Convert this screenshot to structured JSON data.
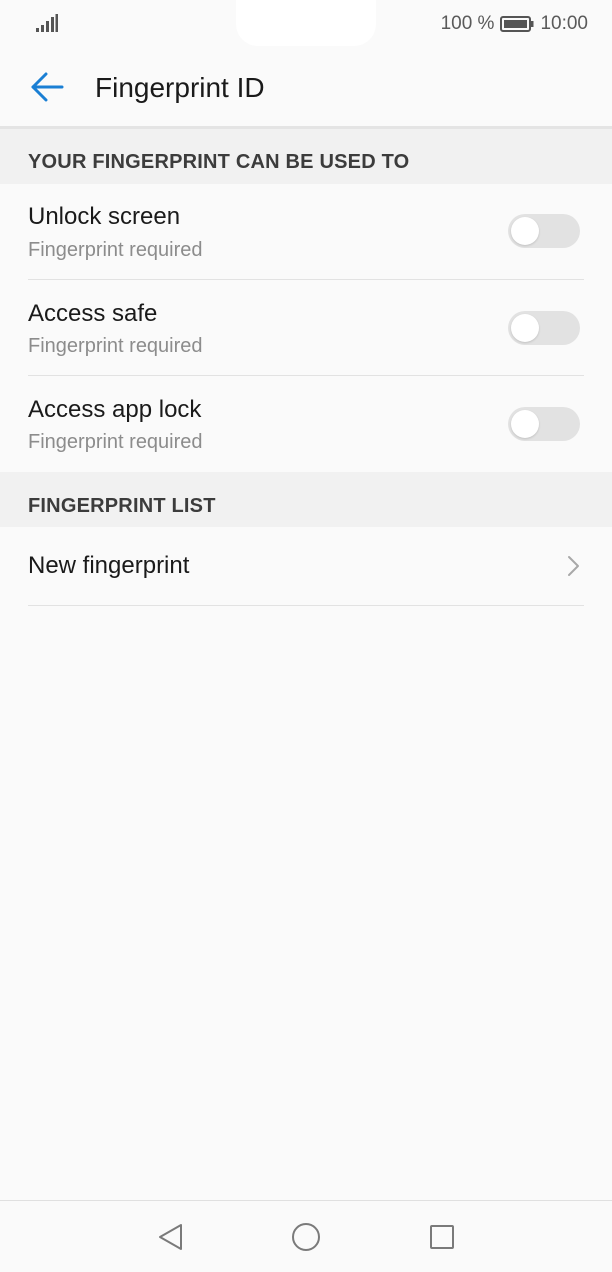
{
  "status_bar": {
    "battery_percent": "100 %",
    "time": "10:00",
    "icons": [
      "signal-icon",
      "battery-icon"
    ]
  },
  "app_bar": {
    "back_icon": "arrow-left-icon",
    "title": "Fingerprint ID"
  },
  "sections": [
    {
      "header": "YOUR FINGERPRINT CAN BE USED TO",
      "items": [
        {
          "title": "Unlock screen",
          "subtitle": "Fingerprint required",
          "switch_on": false
        },
        {
          "title": "Access safe",
          "subtitle": "Fingerprint required",
          "switch_on": false
        },
        {
          "title": "Access app lock",
          "subtitle": "Fingerprint required",
          "switch_on": false
        }
      ]
    },
    {
      "header": "FINGERPRINT LIST",
      "items": [
        {
          "title": "New fingerprint",
          "icon": "chevron-right-icon"
        }
      ]
    }
  ],
  "nav_bar": {
    "icons": [
      "back-triangle-icon",
      "home-circle-icon",
      "recents-square-icon"
    ]
  },
  "colors": {
    "accent": "#1a7fd4",
    "background": "#fafafa",
    "section_header_bg": "#f1f1f1",
    "switch_off": "#e2e2e2",
    "secondary_text": "#8c8c8c"
  }
}
